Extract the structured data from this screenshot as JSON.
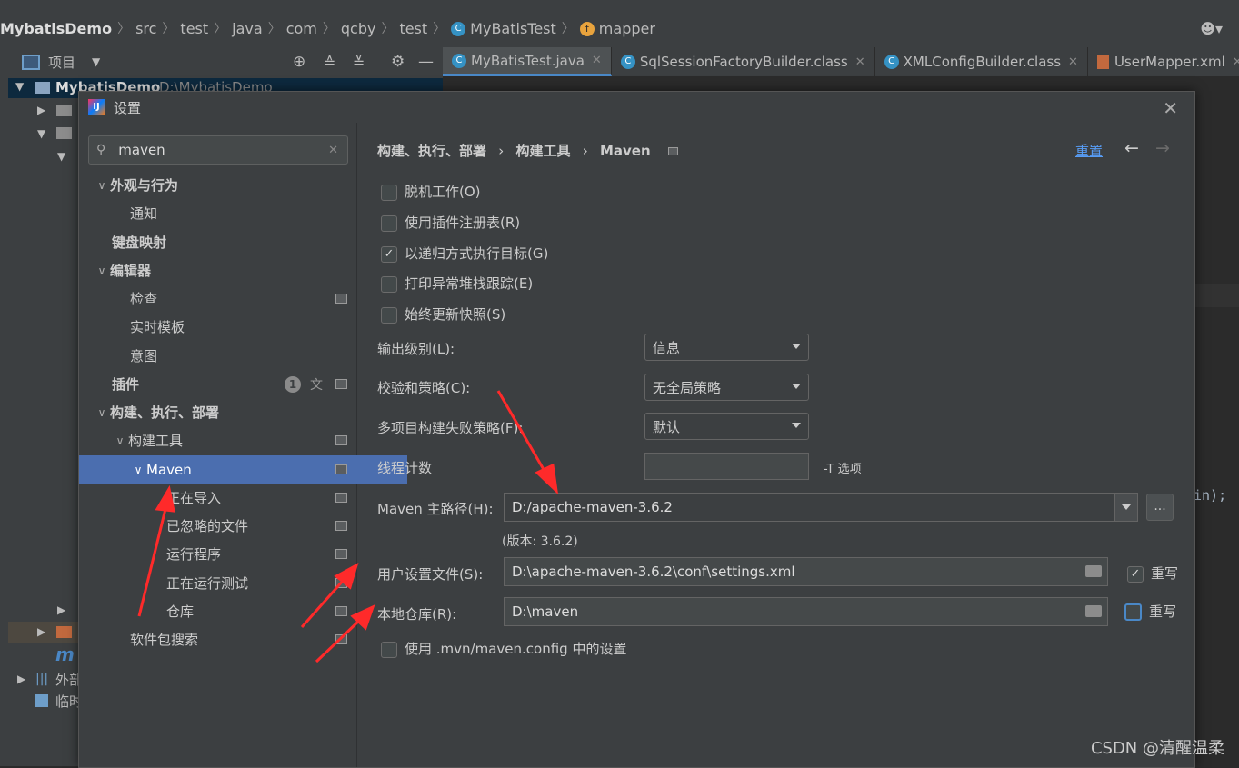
{
  "breadcrumb": {
    "items": [
      "MybatisDemo",
      "src",
      "test",
      "java",
      "com",
      "qcby",
      "test",
      "MyBatisTest",
      "mapper"
    ]
  },
  "project_bar": {
    "label": "项目"
  },
  "editor_tabs": [
    {
      "label": "MyBatisTest.java",
      "icon": "class-c-icon",
      "active": true
    },
    {
      "label": "SqlSessionFactoryBuilder.class",
      "icon": "class-c-icon",
      "active": false
    },
    {
      "label": "XMLConfigBuilder.class",
      "icon": "class-c-icon",
      "active": false
    },
    {
      "label": "UserMapper.xml",
      "icon": "xml-icon",
      "active": false
    }
  ],
  "project_tree": {
    "root_label": "MybatisDemo",
    "root_path": "D:\\MybatisDemo",
    "ext_libs": "外部",
    "scratch": "临时",
    "maven_m": "m"
  },
  "editor_fragment": "in);",
  "dialog": {
    "title": "设置",
    "search": {
      "value": "maven"
    },
    "tree": [
      {
        "label": "外观与行为",
        "level": 0,
        "bold": true,
        "expanded": true
      },
      {
        "label": "通知",
        "level": 1
      },
      {
        "label": "键盘映射",
        "level": 0,
        "bold": true
      },
      {
        "label": "编辑器",
        "level": 0,
        "bold": true,
        "expanded": true
      },
      {
        "label": "检查",
        "level": 1,
        "proj": true
      },
      {
        "label": "实时模板",
        "level": 1
      },
      {
        "label": "意图",
        "level": 1
      },
      {
        "label": "插件",
        "level": 0,
        "bold": true,
        "badge": "1",
        "proj": true
      },
      {
        "label": "构建、执行、部署",
        "level": 0,
        "bold": true,
        "expanded": true
      },
      {
        "label": "构建工具",
        "level": 1,
        "expanded": true,
        "proj": true
      },
      {
        "label": "Maven",
        "level": 2,
        "expanded": true,
        "selected": true,
        "proj": true
      },
      {
        "label": "正在导入",
        "level": 3,
        "proj": true
      },
      {
        "label": "已忽略的文件",
        "level": 3,
        "proj": true
      },
      {
        "label": "运行程序",
        "level": 3,
        "proj": true
      },
      {
        "label": "正在运行测试",
        "level": 3,
        "proj": true
      },
      {
        "label": "仓库",
        "level": 3,
        "proj": true
      },
      {
        "label": "软件包搜索",
        "level": 1,
        "proj": true
      }
    ],
    "header": {
      "crumb1": "构建、执行、部署",
      "crumb2": "构建工具",
      "crumb3": "Maven",
      "reset": "重置"
    },
    "checkboxes": [
      {
        "label": "脱机工作(O)",
        "checked": false
      },
      {
        "label": "使用插件注册表(R)",
        "checked": false
      },
      {
        "label": "以递归方式执行目标(G)",
        "checked": true
      },
      {
        "label": "打印异常堆栈跟踪(E)",
        "checked": false
      },
      {
        "label": "始终更新快照(S)",
        "checked": false
      }
    ],
    "output_level": {
      "label": "输出级别(L):",
      "value": "信息"
    },
    "checksum_policy": {
      "label": "校验和策略(C):",
      "value": "无全局策略"
    },
    "multiproject_fail": {
      "label": "多项目构建失败策略(F):",
      "value": "默认"
    },
    "thread_count": {
      "label": "线程计数",
      "value": "",
      "suffix": "-T 选项"
    },
    "maven_home": {
      "label": "Maven 主路径(H):",
      "value": "D:/apache-maven-3.6.2",
      "version": "(版本: 3.6.2)"
    },
    "user_settings": {
      "label": "用户设置文件(S):",
      "value": "D:\\apache-maven-3.6.2\\conf\\settings.xml",
      "override_label": "重写",
      "override": true
    },
    "local_repo": {
      "label": "本地仓库(R):",
      "value": "D:\\maven",
      "override_label": "重写",
      "override": false
    },
    "use_mvn_config": {
      "label": "使用 .mvn/maven.config 中的设置",
      "checked": false
    }
  },
  "watermark": "CSDN @清醒温柔",
  "colors": {
    "selection": "#4b6eaf",
    "accent_link": "#589df6",
    "annotation": "#ff2a2a"
  }
}
